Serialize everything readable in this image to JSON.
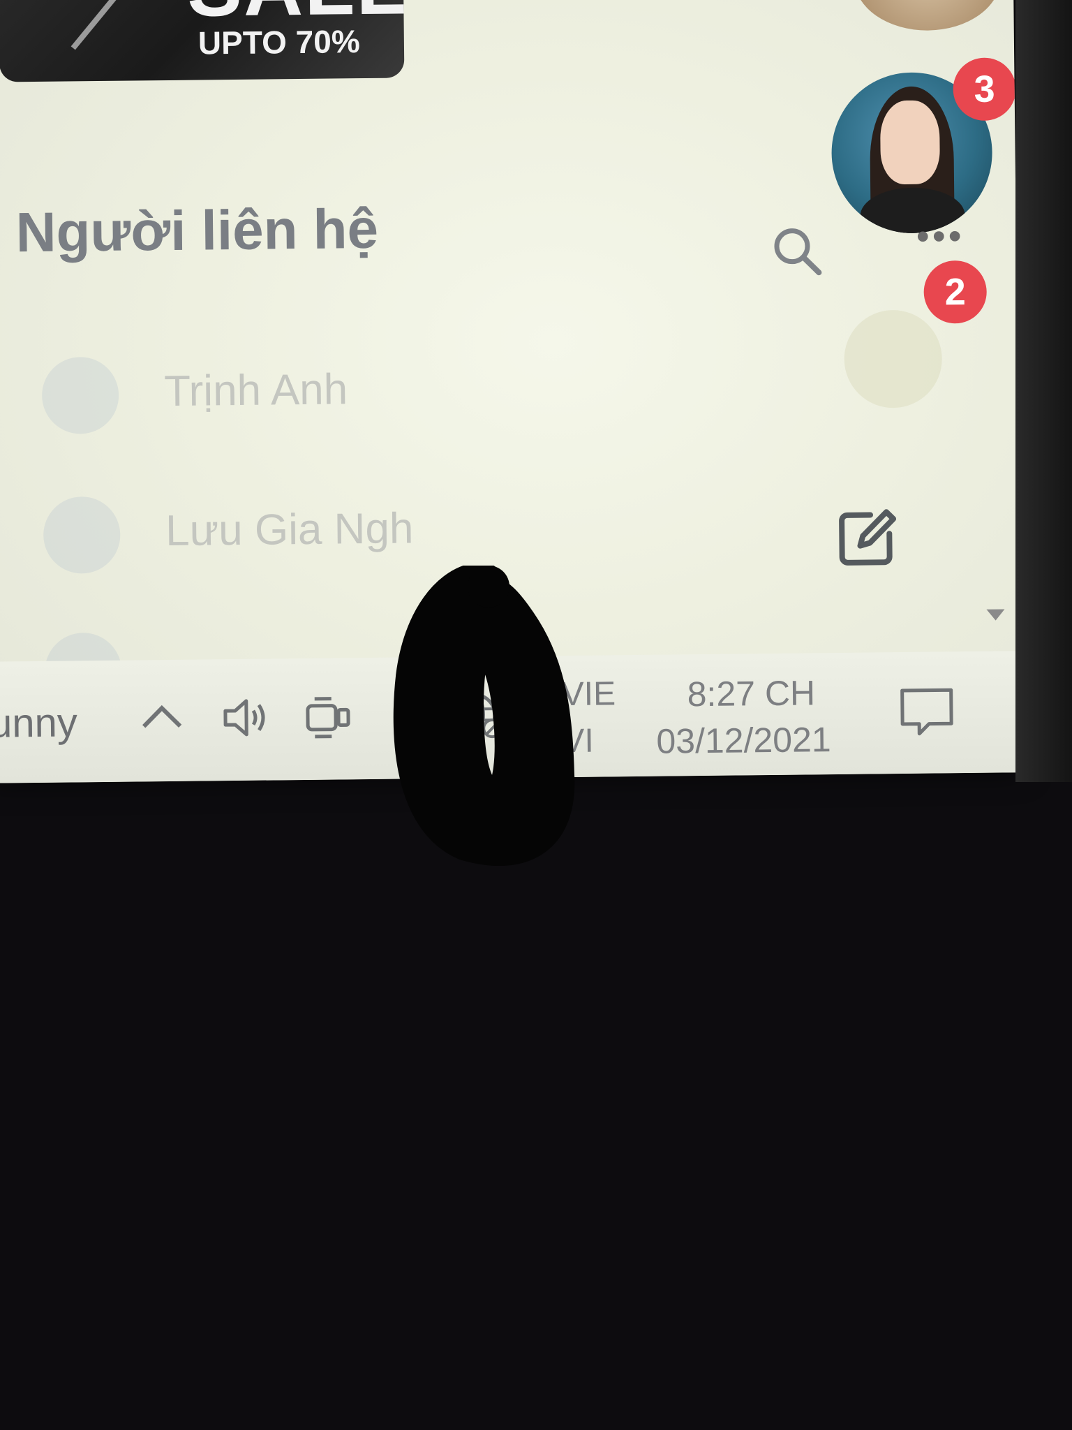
{
  "banner": {
    "title": "SALE",
    "subtitle": "UPTO 70%"
  },
  "contacts": {
    "heading": "Người liên hệ",
    "items": [
      {
        "name": "Trịnh Anh"
      },
      {
        "name": "Lưu Gia Ngh"
      },
      {
        "name": ""
      }
    ],
    "badges": {
      "avatar_count": "3",
      "more_count": "2"
    }
  },
  "taskbar": {
    "weather": "unny",
    "language": {
      "top": "VIE",
      "bottom": "VI"
    },
    "clock": {
      "time": "8:27 CH",
      "date": "03/12/2021"
    }
  },
  "colors": {
    "badge": "#e8474f",
    "screen": "#eef0e0",
    "bezel": "#0d0c0f"
  }
}
